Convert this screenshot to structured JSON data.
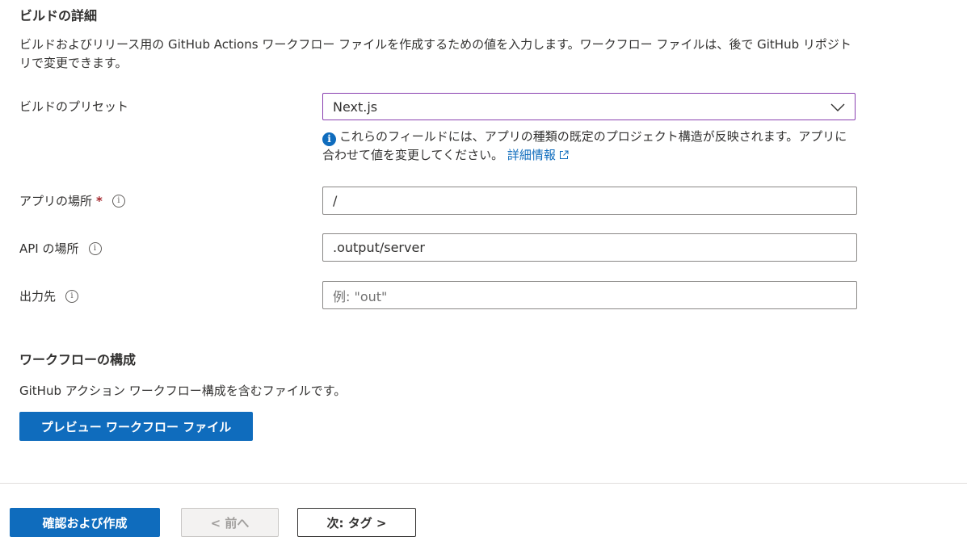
{
  "build_details": {
    "title": "ビルドの詳細",
    "description": "ビルドおよびリリース用の GitHub Actions ワークフロー ファイルを作成するための値を入力します。ワークフロー ファイルは、後で GitHub リポジトリで変更できます。"
  },
  "fields": {
    "preset": {
      "label": "ビルドのプリセット",
      "value": "Next.js",
      "hint": "これらのフィールドには、アプリの種類の既定のプロジェクト構造が反映されます。アプリに合わせて値を変更してください。",
      "hint_link": "詳細情報"
    },
    "app_location": {
      "label": "アプリの場所",
      "required_mark": "*",
      "value": "/"
    },
    "api_location": {
      "label": "API の場所",
      "value": ".output/server"
    },
    "output_location": {
      "label": "出力先",
      "value": "",
      "placeholder": "例: \"out\""
    }
  },
  "workflow": {
    "title": "ワークフローの構成",
    "description": "GitHub アクション ワークフロー構成を含むファイルです。",
    "preview_button": "プレビュー ワークフロー ファイル"
  },
  "footer": {
    "review_create": "確認および作成",
    "previous": "< 前へ",
    "next": "次: タグ >"
  },
  "colors": {
    "primary": "#0f6cbd",
    "focus_border": "#8a40b0",
    "required": "#a4262c"
  }
}
